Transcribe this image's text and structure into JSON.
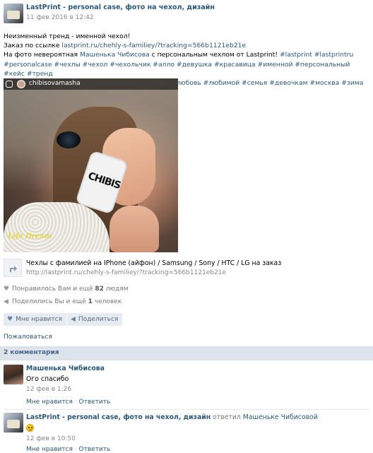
{
  "post": {
    "author": "LastPrint - personal case, фото на чехол, дизайн",
    "date": "11 фев 2016 в 12:42",
    "line1": "Неизменный тренд - именной чехол!",
    "line2_prefix": "Заказ по ссылке ",
    "line2_link": "lastprint.ru/chehly-s-familiey/?tracking=566b1121eb21e",
    "line3_prefix": "На фото невероятная ",
    "line3_name": "Машенька Чибисова",
    "line3_mid": " с персональным чехлом от Lastprint! ",
    "line3_tags": "#lastprint #lastprintru",
    "hashtags_line4": "#personalcase #чехлы #чехол #чехольчик #алло #девушка #красавица #именной #персональный #кейс #тренд",
    "hashtags_line5": "#втренде #праздники #скоро #ура #подарить #любовь #любимой #семья #девочкам #москва #зима"
  },
  "photo": {
    "instagram_user": "chibisovamasha",
    "phone_text": "CHIBIS",
    "watermark": "Life Dream"
  },
  "attachment": {
    "title": "Чехлы с фамилией на IPhone (айфон) / Samsung / Sony / HTC / LG на заказ",
    "url": "http://lastprint.ru/chehly-s-familiey/?tracking=566b1121eb21e"
  },
  "stats": {
    "likes_prefix": "Понравилось Вам и ещё ",
    "likes_count": "82",
    "likes_suffix": " людям",
    "shares_prefix": "Поделились Вы и ещё ",
    "shares_count": "1",
    "shares_suffix": " человек"
  },
  "actions": {
    "like_label": "Мне нравится",
    "share_label": "Поделиться",
    "report_label": "Пожаловаться"
  },
  "comments": {
    "header": "2 комментария",
    "items": [
      {
        "author": "Машенька Чибисова",
        "text": "Ого спасибо",
        "date": "12 фев в 1:26",
        "like": "Мне нравится",
        "sep": " · ",
        "reply": "Ответить"
      },
      {
        "author": "LastPrint - personal case, фото на чехол, дизайн",
        "reply_to_prefix": " ответил ",
        "reply_to": "Машеньке Чибисовой",
        "date": "12 фев в 10:50",
        "like": "Мне нравится",
        "sep": " · ",
        "reply": "Ответить"
      }
    ]
  },
  "icons": {
    "like": "heart-icon",
    "share": "megaphone-icon",
    "attachment": "share-arrow-icon"
  }
}
